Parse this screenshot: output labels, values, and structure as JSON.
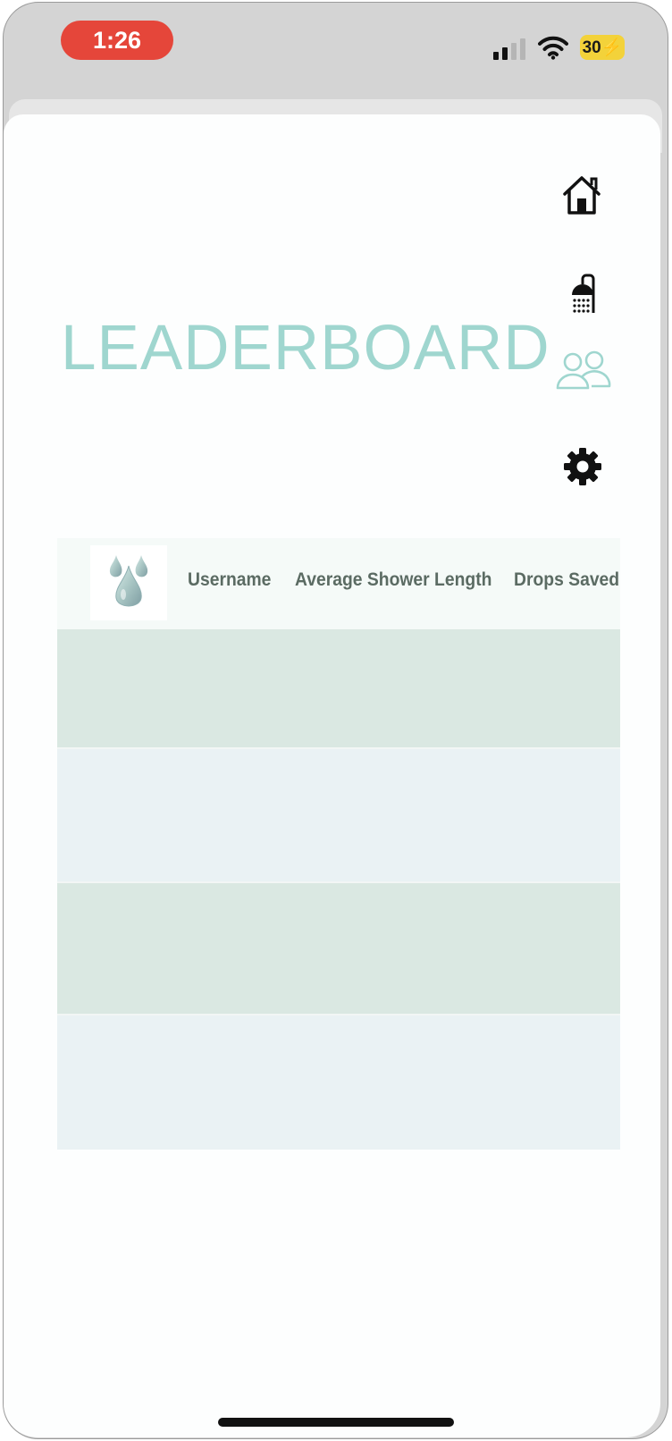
{
  "status_bar": {
    "time": "1:26",
    "battery": "30⚡",
    "icons": [
      "signal-icon",
      "wifi-icon"
    ]
  },
  "page": {
    "title": "LEADERBOARD"
  },
  "nav": {
    "items": [
      {
        "name": "home",
        "icon": "home-icon"
      },
      {
        "name": "shower",
        "icon": "shower-icon"
      },
      {
        "name": "leaderboard",
        "icon": "people-icon",
        "active": true
      },
      {
        "name": "settings",
        "icon": "gear-icon"
      }
    ],
    "active_color": "#9fd6cf",
    "inactive_color": "#111111"
  },
  "table": {
    "logo_icon": "water-drops-icon",
    "columns": [
      "Username",
      "Average Shower Length",
      "Drops Saved"
    ],
    "rows": [
      {
        "username": "",
        "average_shower_length": "",
        "drops_saved": ""
      },
      {
        "username": "",
        "average_shower_length": "",
        "drops_saved": ""
      },
      {
        "username": "",
        "average_shower_length": "",
        "drops_saved": ""
      },
      {
        "username": "",
        "average_shower_length": "",
        "drops_saved": ""
      }
    ],
    "row_colors": [
      "#dae8e2",
      "#eaf2f4"
    ]
  },
  "colors": {
    "accent": "#9fd6cf",
    "status_time_pill": "#e5463a",
    "battery_badge": "#f3d23a"
  }
}
